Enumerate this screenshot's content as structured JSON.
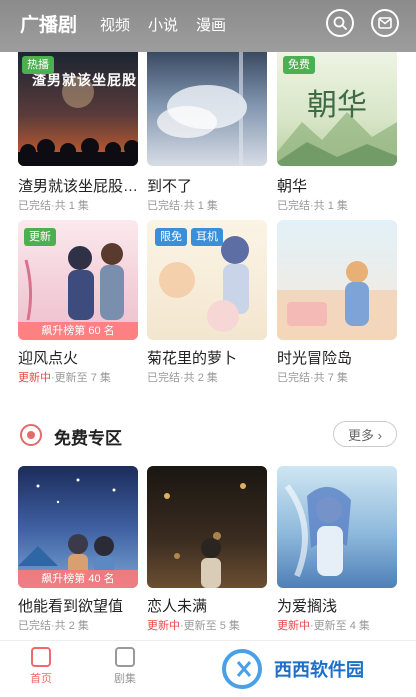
{
  "header": {
    "tabs": [
      {
        "label": "广播剧"
      },
      {
        "label": "视频"
      },
      {
        "label": "小说"
      },
      {
        "label": "漫画"
      }
    ]
  },
  "grid": [
    {
      "title": "渣男就该坐屁股…",
      "meta_status": "",
      "meta": "已完结·共 1 集",
      "badge": "热播",
      "cover_text": "渣男就该坐屁股",
      "rank": ""
    },
    {
      "title": "到不了",
      "meta_status": "",
      "meta": "已完结·共 1 集",
      "badge": "",
      "rank": ""
    },
    {
      "title": "朝华",
      "meta_status": "",
      "meta": "已完结·共 1 集",
      "badge": "免费",
      "cover_text": "朝华",
      "rank": ""
    },
    {
      "title": "迎风点火",
      "meta_status": "更新中",
      "meta": "·更新至 7 集",
      "badge": "更新",
      "rank": "飙升榜第 60 名"
    },
    {
      "title": "菊花里的萝卜",
      "meta_status": "",
      "meta": "已完结·共 2 集",
      "badge": "限免",
      "badge2": "耳机",
      "rank": ""
    },
    {
      "title": "时光冒险岛",
      "meta_status": "",
      "meta": "已完结·共 7 集",
      "badge": "",
      "rank": ""
    }
  ],
  "section": {
    "title": "免费专区",
    "more_label": "更多 ›"
  },
  "free": [
    {
      "title": "他能看到欲望值",
      "meta_status": "",
      "meta": "已完结·共 2 集",
      "rank": "飙升榜第 40 名"
    },
    {
      "title": "恋人未满",
      "meta_status": "更新中",
      "meta": "·更新至 5 集",
      "rank": ""
    },
    {
      "title": "为爱搁浅",
      "meta_status": "更新中",
      "meta": "·更新至 4 集",
      "rank": ""
    }
  ],
  "bottom_nav": [
    {
      "label": "首页",
      "icon": "home-icon",
      "active": true
    },
    {
      "label": "剧集",
      "icon": "list-icon",
      "active": false
    }
  ],
  "watermark": "西西软件园",
  "colors": {
    "accent": "#f06a6a",
    "update": "#e84a4a",
    "header": "#9a9a9a"
  }
}
